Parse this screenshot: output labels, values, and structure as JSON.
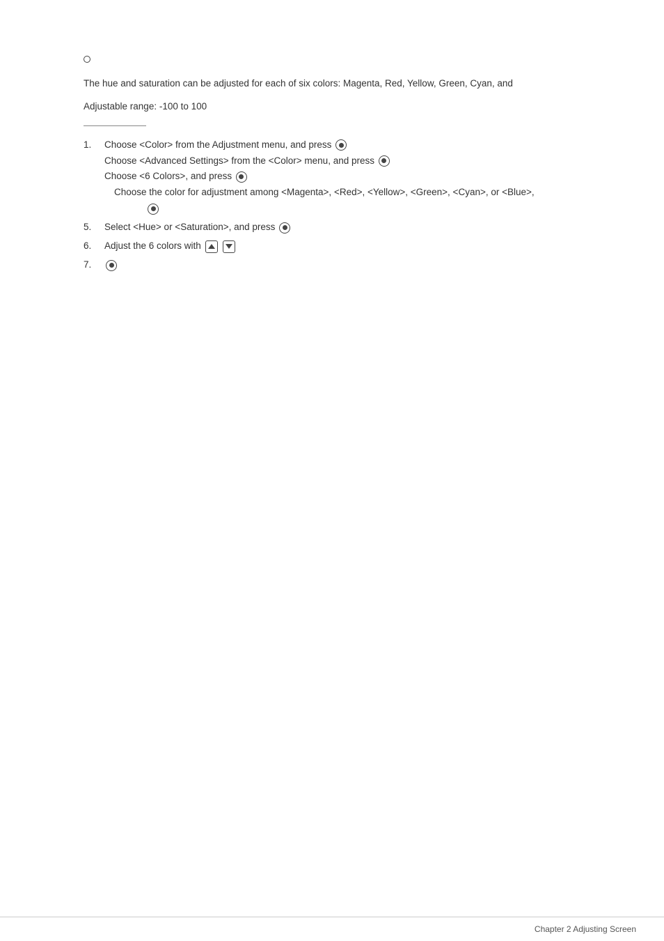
{
  "page": {
    "bullet": "●",
    "intro_text": "The hue and saturation can be adjusted for each of six colors: Magenta, Red, Yellow, Green, Cyan, and",
    "adjustable_range": "Adjustable range: -100 to 100",
    "steps": [
      {
        "number": "1.",
        "lines": [
          "Choose <Color> from the Adjustment menu, and press",
          "Choose <Advanced Settings> from the <Color> menu, and press",
          "Choose <6 Colors>, and press",
          "Choose the color for adjustment among <Magenta>, <Red>, <Yellow>, <Green>, <Cyan>, or <Blue>,"
        ],
        "has_icon": [
          true,
          true,
          true,
          false
        ],
        "extra_icon_line": true
      },
      {
        "number": "5.",
        "lines": [
          "Select <Hue> or <Saturation>, and press"
        ],
        "has_icon": [
          true
        ]
      },
      {
        "number": "6.",
        "lines": [
          "Adjust the 6 colors with"
        ],
        "has_icon": [
          false
        ],
        "has_triangle_icons": true
      },
      {
        "number": "7.",
        "lines": [
          ""
        ],
        "has_icon": [
          true
        ],
        "is_standalone_icon": true
      }
    ],
    "footer": {
      "text": "Chapter 2  Adjusting Screen"
    }
  }
}
